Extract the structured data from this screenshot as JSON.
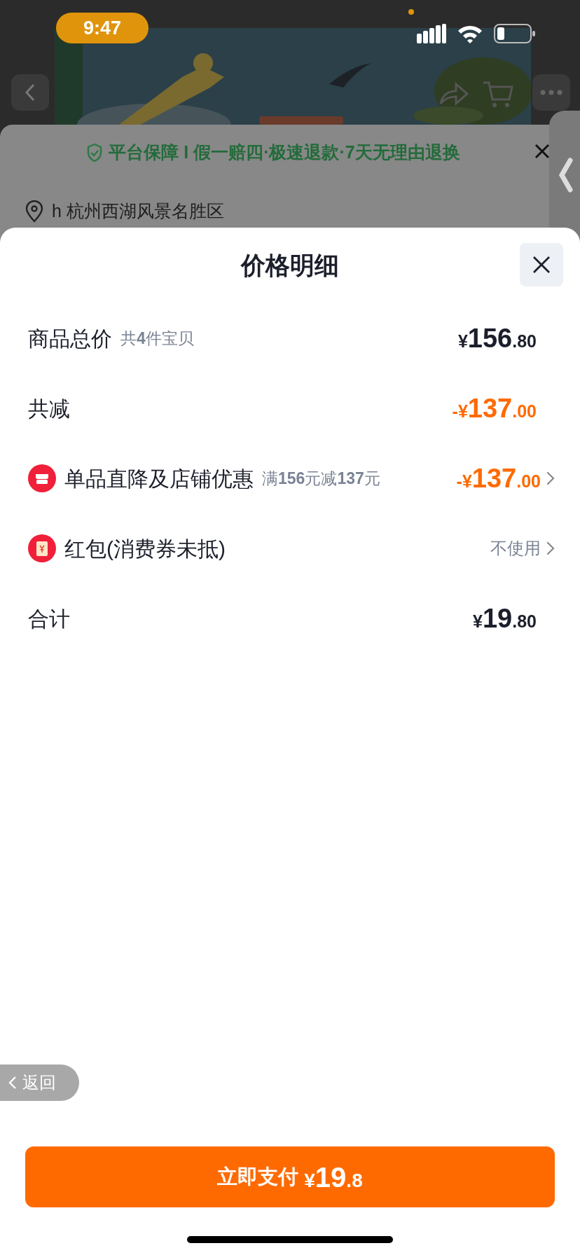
{
  "status_bar": {
    "time": "9:47"
  },
  "product_page": {
    "guarantee": "平台保障 I 假一赔四·极速退款·7天无理由退换",
    "address": "h 杭州西湖风景名胜区"
  },
  "sheet": {
    "title": "价格明细",
    "rows": [
      {
        "kind": "plain",
        "label": "商品总价",
        "note": "共**4**件宝贝",
        "value": "¥156.80",
        "highlight": false,
        "chevron": false
      },
      {
        "kind": "plain",
        "label": "共减",
        "value": "-¥137.00",
        "highlight": true,
        "chevron": false
      },
      {
        "kind": "store",
        "label": "单品直降及店铺优惠",
        "note": "满**156**元减**137**元",
        "value": "-¥137.00",
        "highlight": true,
        "chevron": true
      },
      {
        "kind": "packet",
        "label": "红包(消费券未抵)",
        "value": "不使用",
        "highlight": false,
        "chevron": true
      },
      {
        "kind": "plain",
        "label": "合计",
        "value": "¥19.80",
        "highlight": false,
        "chevron": false
      }
    ]
  },
  "back_pill": "返回",
  "pay_button": {
    "label": "立即支付",
    "amount": "¥19.8"
  }
}
